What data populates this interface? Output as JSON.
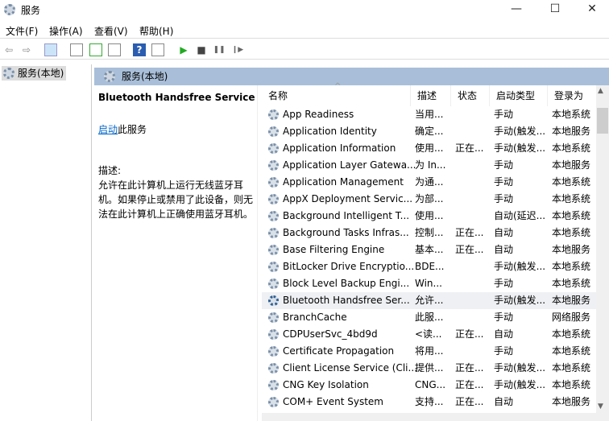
{
  "window": {
    "title": "服务",
    "minimize": "—",
    "maximize": "☐",
    "close": "✕"
  },
  "menu": [
    "文件(F)",
    "操作(A)",
    "查看(V)",
    "帮助(H)"
  ],
  "toolbar": {
    "back": "⇦",
    "forward": "⇨",
    "help": "?",
    "start": "▶",
    "stop": "■",
    "pause": "❚❚",
    "resume": "❙▶"
  },
  "tree": {
    "root": "服务(本地)"
  },
  "header": {
    "title": "服务(本地)"
  },
  "detail": {
    "service_name": "Bluetooth Handsfree Service",
    "start_link": "启动",
    "start_suffix": "此服务",
    "desc_label": "描述:",
    "description": "允许在此计算机上运行无线蓝牙耳机。如果停止或禁用了此设备，则无法在此计算机上正确使用蓝牙耳机。"
  },
  "columns": [
    "名称",
    "描述",
    "状态",
    "启动类型",
    "登录为"
  ],
  "rows": [
    [
      "App Readiness",
      "当用...",
      "",
      "手动",
      "本地系统"
    ],
    [
      "Application Identity",
      "确定...",
      "",
      "手动(触发...",
      "本地服务"
    ],
    [
      "Application Information",
      "使用...",
      "正在...",
      "手动(触发...",
      "本地系统"
    ],
    [
      "Application Layer Gatewa...",
      "为 In...",
      "",
      "手动",
      "本地服务"
    ],
    [
      "Application Management",
      "为通...",
      "",
      "手动",
      "本地系统"
    ],
    [
      "AppX Deployment Servic...",
      "为部...",
      "",
      "手动",
      "本地系统"
    ],
    [
      "Background Intelligent T...",
      "使用...",
      "",
      "自动(延迟...",
      "本地系统"
    ],
    [
      "Background Tasks Infras...",
      "控制...",
      "正在...",
      "自动",
      "本地系统"
    ],
    [
      "Base Filtering Engine",
      "基本...",
      "正在...",
      "自动",
      "本地服务"
    ],
    [
      "BitLocker Drive Encryptio...",
      "BDE...",
      "",
      "手动(触发...",
      "本地系统"
    ],
    [
      "Block Level Backup Engi...",
      "Win...",
      "",
      "手动",
      "本地系统"
    ],
    [
      "Bluetooth Handsfree Ser...",
      "允许...",
      "",
      "手动(触发...",
      "本地服务"
    ],
    [
      "BranchCache",
      "此服...",
      "",
      "手动",
      "网络服务"
    ],
    [
      "CDPUserSvc_4bd9d",
      "<读...",
      "正在...",
      "自动",
      "本地系统"
    ],
    [
      "Certificate Propagation",
      "将用...",
      "",
      "手动",
      "本地系统"
    ],
    [
      "Client License Service (Cli...",
      "提供...",
      "正在...",
      "手动(触发...",
      "本地系统"
    ],
    [
      "CNG Key Isolation",
      "CNG...",
      "正在...",
      "手动(触发...",
      "本地系统"
    ],
    [
      "COM+ Event System",
      "支持...",
      "正在...",
      "自动",
      "本地服务"
    ]
  ],
  "selected_row": 11,
  "colors": {
    "header": "#a9bfd9",
    "link": "#0066cc"
  }
}
